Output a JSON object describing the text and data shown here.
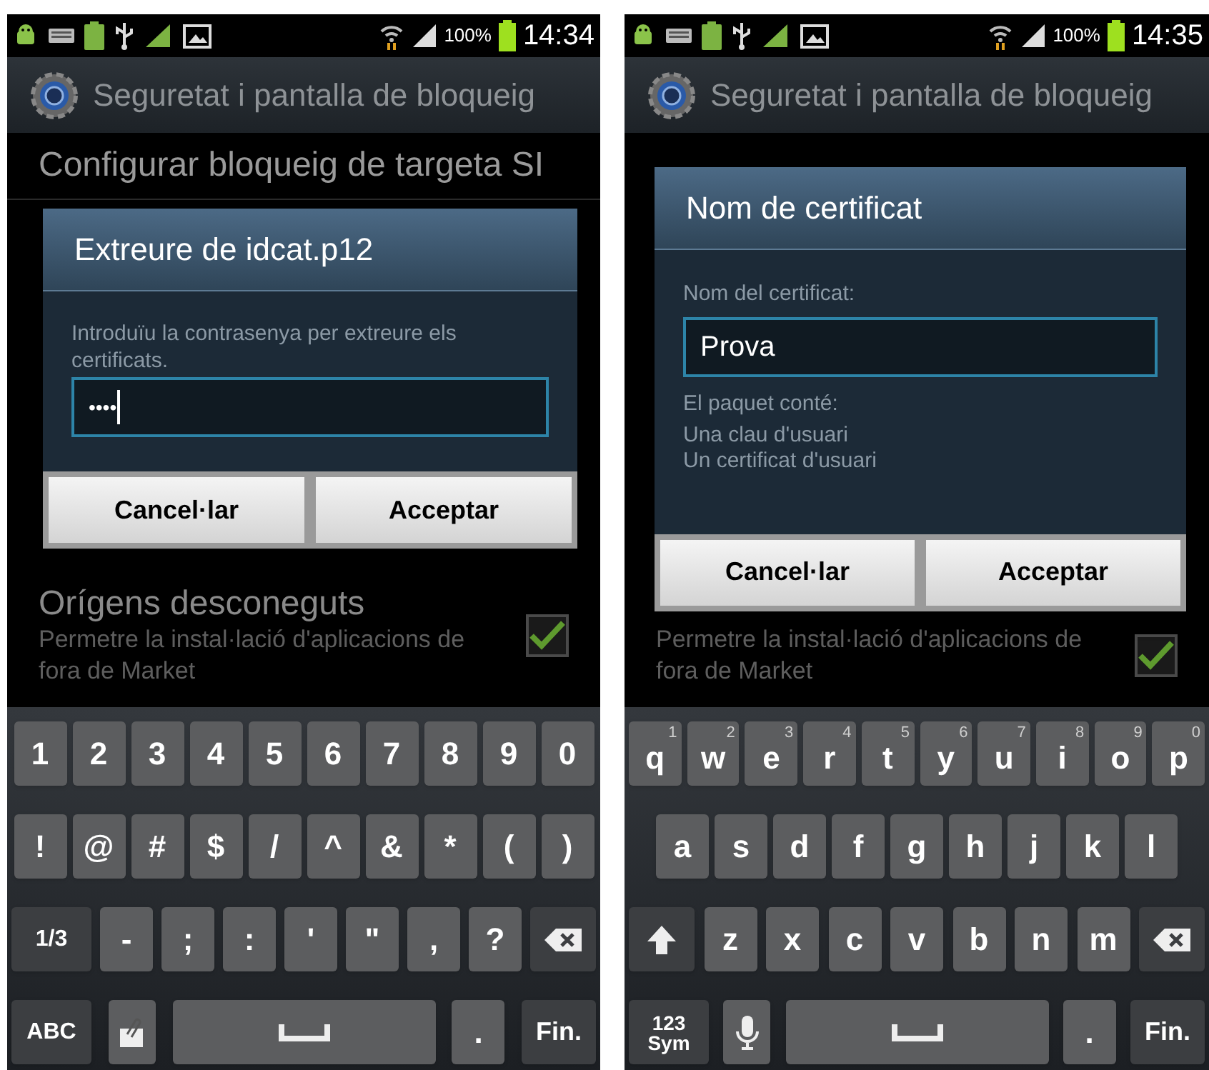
{
  "phones": [
    {
      "status_bar": {
        "battery": "100%",
        "time": "14:34"
      },
      "header": {
        "title": "Seguretat i pantalla de bloqueig"
      },
      "background_items": [
        {
          "kind": "title",
          "title": "Configurar bloqueig de targeta SI"
        },
        {
          "kind": "check",
          "title": "Orígens desconeguts",
          "subtitle": "Permetre la instal·lació d'aplicacions de fora de Market",
          "checked": true
        }
      ],
      "dialog": {
        "title": "Extreure de idcat.p12",
        "message": "Introduïu la contrasenya per extreure els certificats.",
        "field": {
          "kind": "password",
          "value": "••••"
        },
        "buttons": [
          "Cancel·lar",
          "Acceptar"
        ]
      },
      "keyboard": [
        [
          {
            "kind": "char",
            "label": "1"
          },
          {
            "kind": "char",
            "label": "2"
          },
          {
            "kind": "char",
            "label": "3"
          },
          {
            "kind": "char",
            "label": "4"
          },
          {
            "kind": "char",
            "label": "5"
          },
          {
            "kind": "char",
            "label": "6"
          },
          {
            "kind": "char",
            "label": "7"
          },
          {
            "kind": "char",
            "label": "8"
          },
          {
            "kind": "char",
            "label": "9"
          },
          {
            "kind": "char",
            "label": "0"
          }
        ],
        [
          {
            "kind": "char",
            "label": "!"
          },
          {
            "kind": "char",
            "label": "@"
          },
          {
            "kind": "char",
            "label": "#"
          },
          {
            "kind": "char",
            "label": "$"
          },
          {
            "kind": "char",
            "label": "/"
          },
          {
            "kind": "char",
            "label": "^"
          },
          {
            "kind": "char",
            "label": "&"
          },
          {
            "kind": "char",
            "label": "*"
          },
          {
            "kind": "char",
            "label": "("
          },
          {
            "kind": "char",
            "label": ")"
          }
        ],
        [
          {
            "kind": "func",
            "label": "1/3"
          },
          {
            "kind": "char",
            "label": "-"
          },
          {
            "kind": "char",
            "label": ";"
          },
          {
            "kind": "char",
            "label": ":"
          },
          {
            "kind": "char",
            "label": "'"
          },
          {
            "kind": "char",
            "label": "\""
          },
          {
            "kind": "char",
            "label": ","
          },
          {
            "kind": "char",
            "label": "?"
          },
          {
            "kind": "backspace"
          }
        ],
        [
          {
            "kind": "func",
            "label": "ABC"
          },
          {
            "kind": "clip"
          },
          {
            "kind": "space"
          },
          {
            "kind": "char",
            "label": "."
          },
          {
            "kind": "done",
            "label": "Fin."
          }
        ]
      ]
    },
    {
      "status_bar": {
        "battery": "100%",
        "time": "14:35"
      },
      "header": {
        "title": "Seguretat i pantalla de bloqueig"
      },
      "background_items": [
        {
          "kind": "check",
          "subtitle": "Permetre la instal·lació d'aplicacions de fora de Market",
          "checked": true
        }
      ],
      "dialog": {
        "title": "Nom de certificat",
        "label": "Nom del certificat:",
        "field": {
          "kind": "text",
          "value": "Prova"
        },
        "info": [
          "El paquet conté:",
          "Una clau d'usuari",
          "Un certificat d'usuari"
        ],
        "buttons": [
          "Cancel·lar",
          "Acceptar"
        ]
      },
      "keyboard": [
        [
          {
            "kind": "char",
            "label": "q",
            "hint": "1"
          },
          {
            "kind": "char",
            "label": "w",
            "hint": "2"
          },
          {
            "kind": "char",
            "label": "e",
            "hint": "3"
          },
          {
            "kind": "char",
            "label": "r",
            "hint": "4"
          },
          {
            "kind": "char",
            "label": "t",
            "hint": "5"
          },
          {
            "kind": "char",
            "label": "y",
            "hint": "6"
          },
          {
            "kind": "char",
            "label": "u",
            "hint": "7"
          },
          {
            "kind": "char",
            "label": "i",
            "hint": "8"
          },
          {
            "kind": "char",
            "label": "o",
            "hint": "9"
          },
          {
            "kind": "char",
            "label": "p",
            "hint": "0"
          }
        ],
        [
          {
            "kind": "char",
            "label": "a"
          },
          {
            "kind": "char",
            "label": "s"
          },
          {
            "kind": "char",
            "label": "d"
          },
          {
            "kind": "char",
            "label": "f"
          },
          {
            "kind": "char",
            "label": "g"
          },
          {
            "kind": "char",
            "label": "h"
          },
          {
            "kind": "char",
            "label": "j"
          },
          {
            "kind": "char",
            "label": "k"
          },
          {
            "kind": "char",
            "label": "l"
          }
        ],
        [
          {
            "kind": "shift"
          },
          {
            "kind": "char",
            "label": "z"
          },
          {
            "kind": "char",
            "label": "x"
          },
          {
            "kind": "char",
            "label": "c"
          },
          {
            "kind": "char",
            "label": "v"
          },
          {
            "kind": "char",
            "label": "b"
          },
          {
            "kind": "char",
            "label": "n"
          },
          {
            "kind": "char",
            "label": "m"
          },
          {
            "kind": "backspace"
          }
        ],
        [
          {
            "kind": "func",
            "label": "123",
            "sublabel": "Sym"
          },
          {
            "kind": "mic"
          },
          {
            "kind": "space"
          },
          {
            "kind": "char",
            "label": "."
          },
          {
            "kind": "done",
            "label": "Fin."
          }
        ]
      ]
    }
  ]
}
